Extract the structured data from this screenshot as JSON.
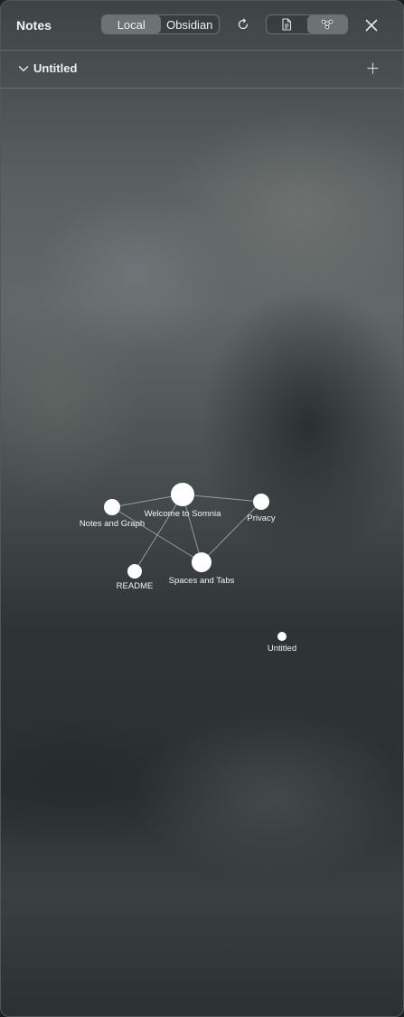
{
  "header": {
    "title": "Notes",
    "source_toggle": {
      "options": [
        "Local",
        "Obsidian"
      ],
      "selected": "Local"
    },
    "view_toggle": {
      "options": [
        "document-icon",
        "graph-icon"
      ],
      "selected": "graph-icon"
    },
    "refresh_icon": "refresh-icon",
    "close_icon": "close-icon"
  },
  "section": {
    "title": "Untitled",
    "expanded": true,
    "add_icon": "plus-icon"
  },
  "graph": {
    "nodes": [
      {
        "id": "welcome",
        "label": "Welcome to Somnia"
      },
      {
        "id": "notes",
        "label": "Notes and Graph"
      },
      {
        "id": "privacy",
        "label": "Privacy"
      },
      {
        "id": "spaces",
        "label": "Spaces and Tabs"
      },
      {
        "id": "readme",
        "label": "README"
      },
      {
        "id": "untitled",
        "label": "Untitled"
      }
    ],
    "edges": [
      [
        "notes",
        "welcome"
      ],
      [
        "welcome",
        "privacy"
      ],
      [
        "welcome",
        "spaces"
      ],
      [
        "welcome",
        "readme"
      ],
      [
        "notes",
        "spaces"
      ],
      [
        "spaces",
        "privacy"
      ]
    ]
  },
  "colors": {
    "node": "#ffffff",
    "panel_border": "#50585a"
  }
}
